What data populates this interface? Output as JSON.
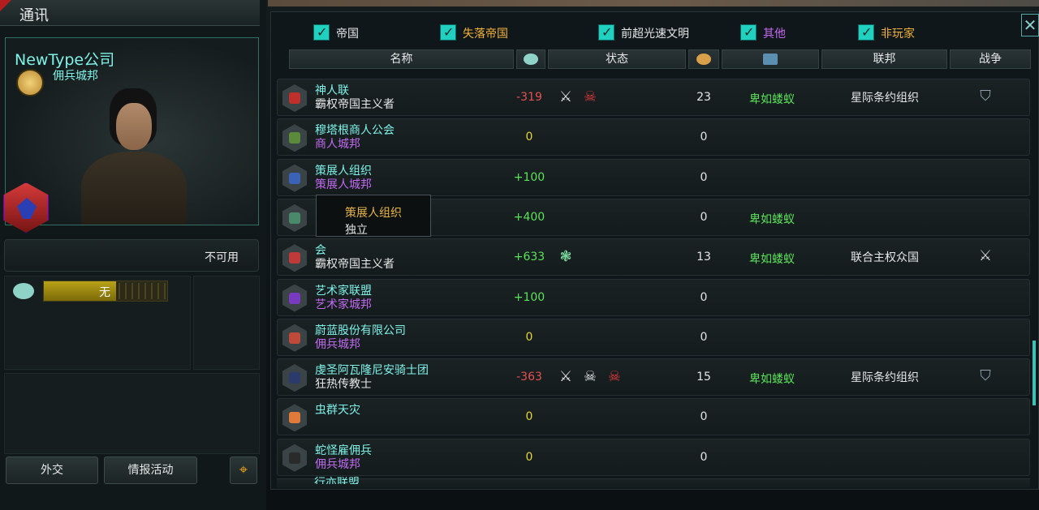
{
  "window": {
    "title": "通讯",
    "close_icon": "close-icon"
  },
  "profile": {
    "name": "NewType公司",
    "type": "佣兵城邦",
    "status": "不可用",
    "opinion_label": "无",
    "opinion_fill": 0.58
  },
  "left_buttons": {
    "diplomacy": "外交",
    "intel": "情报活动"
  },
  "filters": [
    {
      "label": "帝国",
      "checked": true,
      "color": "#e6e6e6"
    },
    {
      "label": "失落帝国",
      "checked": true,
      "color": "#f0b23a"
    },
    {
      "label": "前超光速文明",
      "checked": true,
      "color": "#e6e6e6"
    },
    {
      "label": "其他",
      "checked": true,
      "color": "#c26af0"
    },
    {
      "label": "非玩家",
      "checked": true,
      "color": "#f0b23a"
    }
  ],
  "columns": {
    "name": "名称",
    "status": "状态",
    "federation": "联邦",
    "war": "战争"
  },
  "rows": [
    {
      "name": "神人联",
      "sub": "霸权帝国主义者",
      "sub_color": "wht",
      "opinion": "-319",
      "op_color": "red",
      "status_icons": [
        "⚔",
        "☠"
      ],
      "planets": "23",
      "power": "卑如蝼蚁",
      "federation": "星际条约组织",
      "war": "shield",
      "icon_bg": "#c0302a"
    },
    {
      "name": "穆塔根商人公会",
      "sub": "商人城邦",
      "sub_color": "pur",
      "opinion": "0",
      "op_color": "yel",
      "status_icons": [],
      "planets": "0",
      "power": "",
      "federation": "",
      "war": "",
      "icon_bg": "#5a8a3a"
    },
    {
      "name": "策展人组织",
      "sub": "策展人城邦",
      "sub_color": "pur",
      "opinion": "+100",
      "op_color": "grn",
      "status_icons": [],
      "planets": "0",
      "power": "",
      "federation": "",
      "war": "",
      "icon_bg": "#3a63b8"
    },
    {
      "name": "",
      "sub": "",
      "sub_color": "pur",
      "opinion": "+400",
      "op_color": "grn",
      "status_icons": [],
      "planets": "0",
      "power": "卑如蝼蚁",
      "federation": "",
      "war": "",
      "icon_bg": "#4a8a6a"
    },
    {
      "name": "会",
      "sub": "霸权帝国主义者",
      "sub_color": "wht",
      "opinion": "+633",
      "op_color": "grn",
      "status_icons": [
        "❃"
      ],
      "planets": "13",
      "power": "卑如蝼蚁",
      "federation": "联合主权众国",
      "war": "swords",
      "icon_bg": "#c03a3a"
    },
    {
      "name": "艺术家联盟",
      "sub": "艺术家城邦",
      "sub_color": "pur",
      "opinion": "+100",
      "op_color": "grn",
      "status_icons": [],
      "planets": "0",
      "power": "",
      "federation": "",
      "war": "",
      "icon_bg": "#7a3ac0"
    },
    {
      "name": "蔚蓝股份有限公司",
      "sub": "佣兵城邦",
      "sub_color": "pur",
      "opinion": "0",
      "op_color": "yel",
      "status_icons": [],
      "planets": "0",
      "power": "",
      "federation": "",
      "war": "",
      "icon_bg": "#c04a3a"
    },
    {
      "name": "虔圣阿瓦隆尼安骑士团",
      "sub": "狂热传教士",
      "sub_color": "wht",
      "opinion": "-363",
      "op_color": "red",
      "status_icons": [
        "⚔",
        "☠",
        "☠"
      ],
      "planets": "15",
      "power": "卑如蝼蚁",
      "federation": "星际条约组织",
      "war": "shield",
      "icon_bg": "#2a3a6a"
    },
    {
      "name": "虫群天灾",
      "sub": "",
      "sub_color": "pur",
      "opinion": "0",
      "op_color": "yel",
      "status_icons": [],
      "planets": "0",
      "power": "",
      "federation": "",
      "war": "",
      "icon_bg": "#e07a3a"
    },
    {
      "name": "蛇怪雇佣兵",
      "sub": "佣兵城邦",
      "sub_color": "pur",
      "opinion": "0",
      "op_color": "yel",
      "status_icons": [],
      "planets": "0",
      "power": "",
      "federation": "",
      "war": "",
      "icon_bg": "#2a2a2a"
    }
  ],
  "cut_row": {
    "name": "行亦联盟"
  },
  "tooltip": {
    "title": "策展人组织",
    "line": "独立"
  }
}
